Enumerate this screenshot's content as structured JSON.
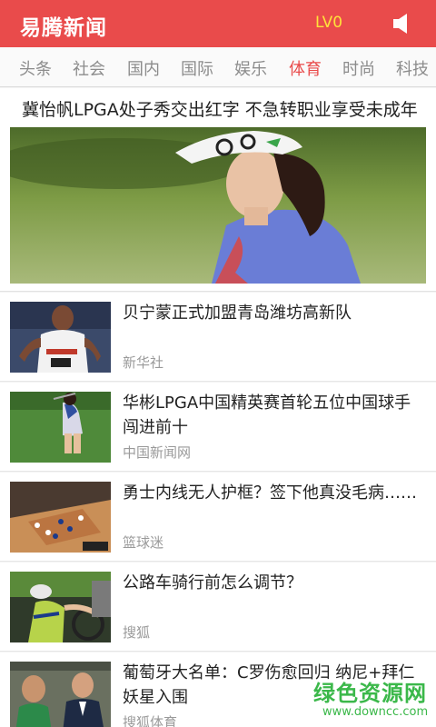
{
  "header": {
    "app_name": "易腾新闻",
    "level": "LV0",
    "speaker_icon": "speaker-icon",
    "background": "#e94b4b",
    "level_color": "#ffe23a"
  },
  "tabs": [
    {
      "label": "头条",
      "active": false
    },
    {
      "label": "社会",
      "active": false
    },
    {
      "label": "国内",
      "active": false
    },
    {
      "label": "国际",
      "active": false
    },
    {
      "label": "娱乐",
      "active": false
    },
    {
      "label": "体育",
      "active": true
    },
    {
      "label": "时尚",
      "active": false
    },
    {
      "label": "科技",
      "active": false
    }
  ],
  "headline": {
    "title": "冀怡帆LPGA处子秀交出红字 不急转职业享受未成年"
  },
  "news": [
    {
      "title": "贝宁蒙正式加盟青岛潍坊高新队",
      "source": "新华社"
    },
    {
      "title": "华彬LPGA中国精英赛首轮五位中国球手闯进前十",
      "source": "中国新闻网"
    },
    {
      "title": "勇士内线无人护框？签下他真没毛病……",
      "source": "篮球迷"
    },
    {
      "title": "公路车骑行前怎么调节？",
      "source": "搜狐"
    },
    {
      "title": "葡萄牙大名单：C罗伤愈回归 纳尼+拜仁妖星入围",
      "source": "搜狐体育"
    }
  ],
  "watermark": {
    "title": "绿色资源网",
    "url": "www.downcc.com"
  }
}
